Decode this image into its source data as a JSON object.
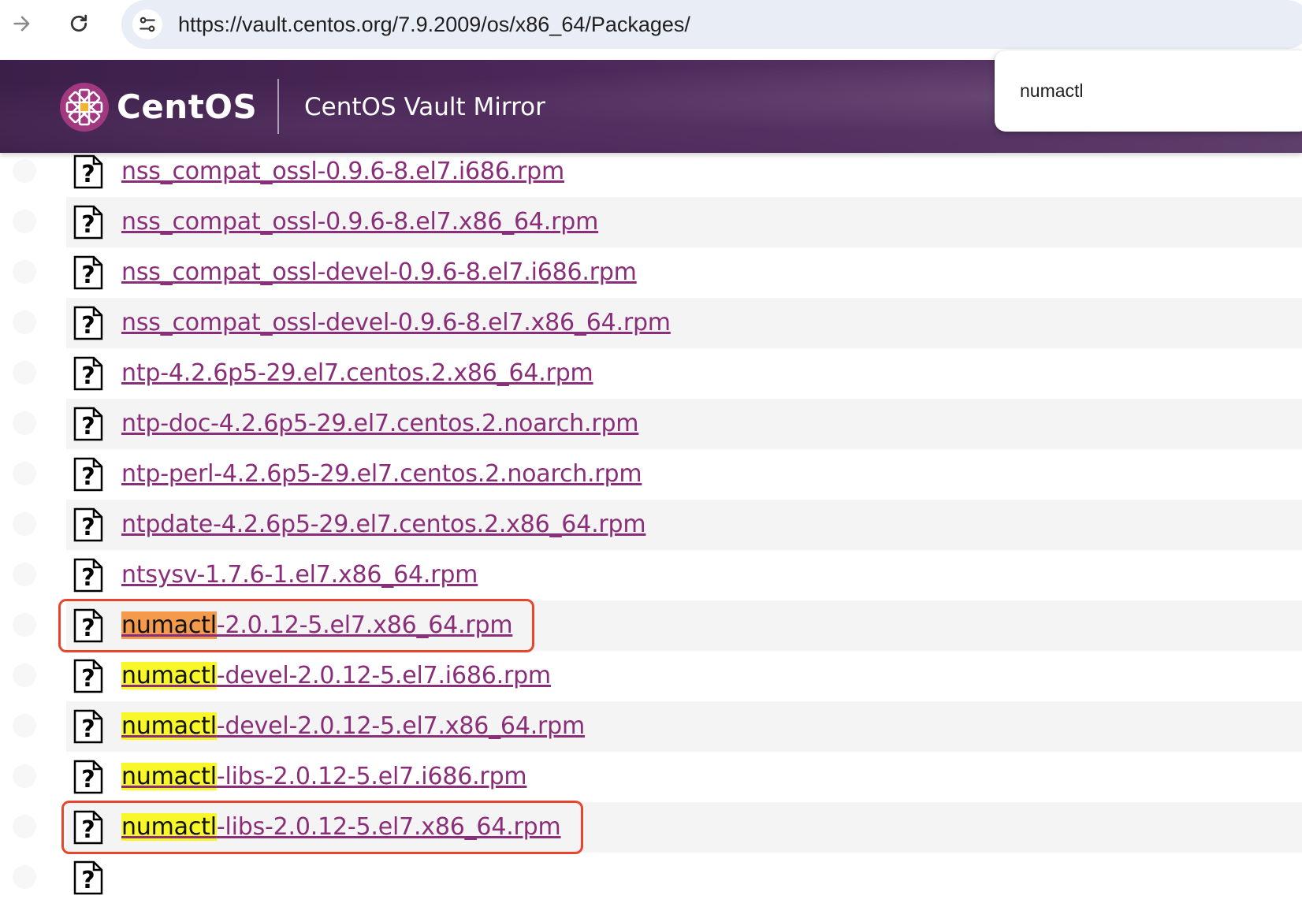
{
  "browser": {
    "url": "https://vault.centos.org/7.9.2009/os/x86_64/Packages/",
    "forward_icon": "arrow-forward-icon",
    "reload_icon": "reload-icon",
    "site_info_icon": "tune-icon"
  },
  "header": {
    "logo_text": "CentOS",
    "title": "CentOS Vault Mirror"
  },
  "find_bar": {
    "query": "numactl"
  },
  "colors": {
    "link": "#8a2e7a",
    "header_bg": "#4a2758",
    "active_match": "#f49a4c",
    "match": "#f7f72a",
    "annotation": "#e8452c"
  },
  "files": [
    {
      "prefix": "",
      "rest": "nss_compat_ossl-0.9.6-8.el7.i686.rpm",
      "highlight": "none"
    },
    {
      "prefix": "",
      "rest": "nss_compat_ossl-0.9.6-8.el7.x86_64.rpm",
      "highlight": "none"
    },
    {
      "prefix": "",
      "rest": "nss_compat_ossl-devel-0.9.6-8.el7.i686.rpm",
      "highlight": "none"
    },
    {
      "prefix": "",
      "rest": "nss_compat_ossl-devel-0.9.6-8.el7.x86_64.rpm",
      "highlight": "none"
    },
    {
      "prefix": "",
      "rest": "ntp-4.2.6p5-29.el7.centos.2.x86_64.rpm",
      "highlight": "none"
    },
    {
      "prefix": "",
      "rest": "ntp-doc-4.2.6p5-29.el7.centos.2.noarch.rpm",
      "highlight": "none"
    },
    {
      "prefix": "",
      "rest": "ntp-perl-4.2.6p5-29.el7.centos.2.noarch.rpm",
      "highlight": "none"
    },
    {
      "prefix": "",
      "rest": "ntpdate-4.2.6p5-29.el7.centos.2.x86_64.rpm",
      "highlight": "none"
    },
    {
      "prefix": "",
      "rest": "ntsysv-1.7.6-1.el7.x86_64.rpm",
      "highlight": "none"
    },
    {
      "prefix": "numactl",
      "rest": "-2.0.12-5.el7.x86_64.rpm",
      "highlight": "active"
    },
    {
      "prefix": "numactl",
      "rest": "-devel-2.0.12-5.el7.i686.rpm",
      "highlight": "match"
    },
    {
      "prefix": "numactl",
      "rest": "-devel-2.0.12-5.el7.x86_64.rpm",
      "highlight": "match"
    },
    {
      "prefix": "numactl",
      "rest": "-libs-2.0.12-5.el7.i686.rpm",
      "highlight": "match"
    },
    {
      "prefix": "numactl",
      "rest": "-libs-2.0.12-5.el7.x86_64.rpm",
      "highlight": "match"
    },
    {
      "prefix": "",
      "rest": "",
      "highlight": "none"
    }
  ],
  "annotations": [
    {
      "file_index": 9
    },
    {
      "file_index": 13
    }
  ]
}
